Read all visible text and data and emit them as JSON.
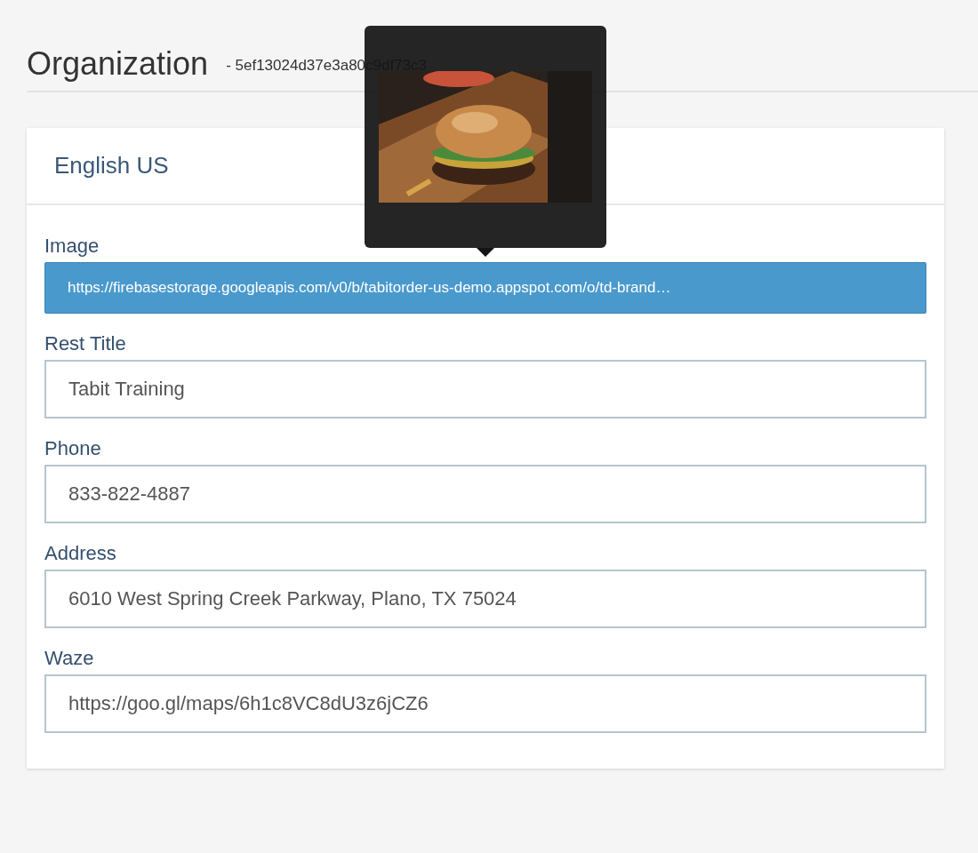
{
  "page": {
    "title": "Organization",
    "id": "- 5ef13024d37e3a80c9df73c3"
  },
  "card": {
    "title": "English US"
  },
  "fields": [
    {
      "label": "Image",
      "value": "https://firebasestorage.googleapis.com/v0/b/tabitorder-us-demo.appspot.com/o/td-brand…",
      "focused": true
    },
    {
      "label": "Rest Title",
      "value": "Tabit Training",
      "focused": false
    },
    {
      "label": "Phone",
      "value": "833-822-4887",
      "focused": false
    },
    {
      "label": "Address",
      "value": "6010 West Spring Creek Parkway, Plano, TX 75024",
      "focused": false
    },
    {
      "label": "Waze",
      "value": "https://goo.gl/maps/6h1c8VC8dU3z6jCZ6",
      "focused": false
    }
  ]
}
